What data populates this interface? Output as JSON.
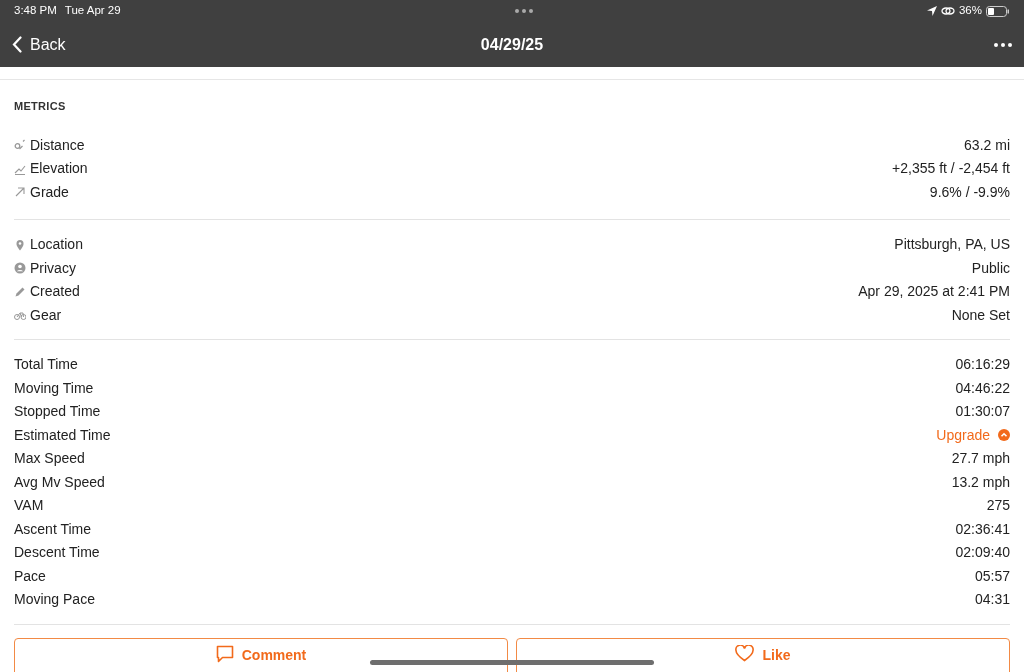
{
  "status_bar": {
    "time": "3:48 PM",
    "date": "Tue Apr 29",
    "battery": "36%"
  },
  "nav": {
    "back": "Back",
    "title": "04/29/25"
  },
  "section_title": "METRICS",
  "groups": [
    {
      "kind": "icons",
      "rows": [
        {
          "label": "Distance",
          "value": "63.2 mi"
        },
        {
          "label": "Elevation",
          "value": "+2,355 ft / -2,454 ft"
        },
        {
          "label": "Grade",
          "value": "9.6% / -9.9%"
        }
      ]
    },
    {
      "kind": "icons",
      "rows": [
        {
          "label": "Location",
          "value": "Pittsburgh, PA, US"
        },
        {
          "label": "Privacy",
          "value": "Public"
        },
        {
          "label": "Created",
          "value": "Apr 29, 2025 at 2:41 PM"
        },
        {
          "label": "Gear",
          "value": "None Set"
        }
      ]
    },
    {
      "kind": "plain",
      "rows": [
        {
          "label": "Total Time",
          "value": "06:16:29"
        },
        {
          "label": "Moving Time",
          "value": "04:46:22"
        },
        {
          "label": "Stopped Time",
          "value": "01:30:07"
        },
        {
          "label": "Estimated Time",
          "value": "Upgrade",
          "kind": "upgrade"
        },
        {
          "label": "Max Speed",
          "value": "27.7 mph"
        },
        {
          "label": "Avg Mv Speed",
          "value": "13.2 mph"
        },
        {
          "label": "VAM",
          "value": "275"
        },
        {
          "label": "Ascent Time",
          "value": "02:36:41"
        },
        {
          "label": "Descent Time",
          "value": "02:09:40"
        },
        {
          "label": "Pace",
          "value": "05:57"
        },
        {
          "label": "Moving Pace",
          "value": "04:31"
        }
      ]
    }
  ],
  "actions": [
    {
      "kind": "comment",
      "label": "Comment"
    },
    {
      "kind": "like",
      "label": "Like"
    }
  ]
}
